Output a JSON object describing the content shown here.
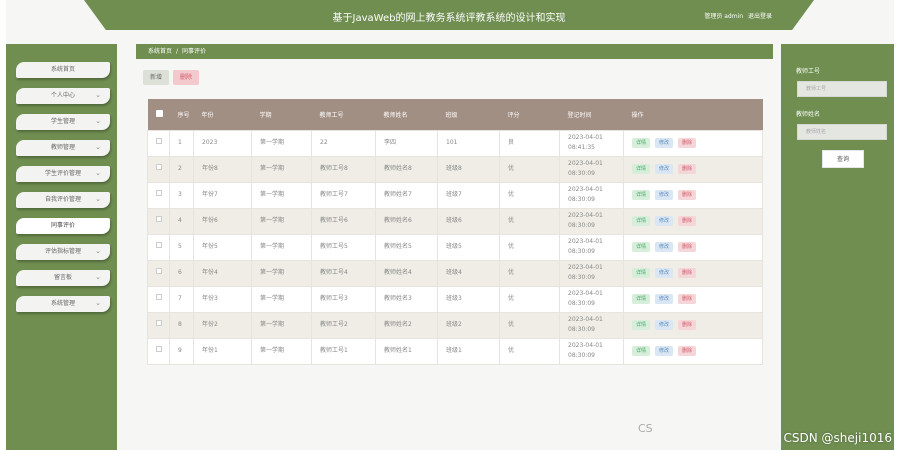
{
  "header": {
    "title": "基于JavaWeb的网上教务系统评教系统的设计和实现",
    "user_label": "管理员 admin",
    "logout_label": "退出登录"
  },
  "sidebar": {
    "items": [
      {
        "label": "系统首页",
        "has_chevron": false
      },
      {
        "label": "个人中心",
        "has_chevron": true
      },
      {
        "label": "学生管理",
        "has_chevron": true
      },
      {
        "label": "教师管理",
        "has_chevron": true
      },
      {
        "label": "学生评价管理",
        "has_chevron": true
      },
      {
        "label": "自我评价管理",
        "has_chevron": true
      },
      {
        "label": "同事评价",
        "has_chevron": false,
        "active": true
      },
      {
        "label": "评估指标管理",
        "has_chevron": true
      },
      {
        "label": "留言板",
        "has_chevron": true
      },
      {
        "label": "系统管理",
        "has_chevron": true
      }
    ]
  },
  "breadcrumb": {
    "home": "系统首页",
    "separator": "/",
    "current": "同事评价"
  },
  "toolbar": {
    "add_label": "新增",
    "delete_label": "删除"
  },
  "table": {
    "headers": [
      "序号",
      "年份",
      "学期",
      "教师工号",
      "教师姓名",
      "班级",
      "评分",
      "登记时间",
      "操作"
    ],
    "rows": [
      [
        "1",
        "2023",
        "第一学期",
        "22",
        "李四",
        "101",
        "良",
        "2023-04-01 08:41:35"
      ],
      [
        "2",
        "年份8",
        "第一学期",
        "教师工号8",
        "教师姓名8",
        "班级8",
        "优",
        "2023-04-01 08:30:09"
      ],
      [
        "3",
        "年份7",
        "第一学期",
        "教师工号7",
        "教师姓名7",
        "班级7",
        "优",
        "2023-04-01 08:30:09"
      ],
      [
        "4",
        "年份6",
        "第一学期",
        "教师工号6",
        "教师姓名6",
        "班级6",
        "优",
        "2023-04-01 08:30:09"
      ],
      [
        "5",
        "年份5",
        "第一学期",
        "教师工号5",
        "教师姓名5",
        "班级5",
        "优",
        "2023-04-01 08:30:09"
      ],
      [
        "6",
        "年份4",
        "第一学期",
        "教师工号4",
        "教师姓名4",
        "班级4",
        "优",
        "2023-04-01 08:30:09"
      ],
      [
        "7",
        "年份3",
        "第一学期",
        "教师工号3",
        "教师姓名3",
        "班级3",
        "优",
        "2023-04-01 08:30:09"
      ],
      [
        "8",
        "年份2",
        "第一学期",
        "教师工号2",
        "教师姓名2",
        "班级2",
        "优",
        "2023-04-01 08:30:09"
      ],
      [
        "9",
        "年份1",
        "第一学期",
        "教师工号1",
        "教师姓名1",
        "班级1",
        "优",
        "2023-04-01 08:30:09"
      ]
    ],
    "actions": {
      "detail": "详情",
      "edit": "修改",
      "delete": "删除"
    }
  },
  "search": {
    "teacher_id_label": "教师工号",
    "teacher_id_placeholder": "教师工号",
    "teacher_name_label": "教师姓名",
    "teacher_name_placeholder": "教师姓名",
    "button": "查询"
  },
  "watermark": {
    "left": "CS",
    "right": "CSDN @sheji1016"
  },
  "colors": {
    "accent": "#6f8e50",
    "table_header": "#a28f84",
    "detail": "#4aa66a",
    "edit": "#5b8cc4",
    "delete": "#d45a6a"
  }
}
